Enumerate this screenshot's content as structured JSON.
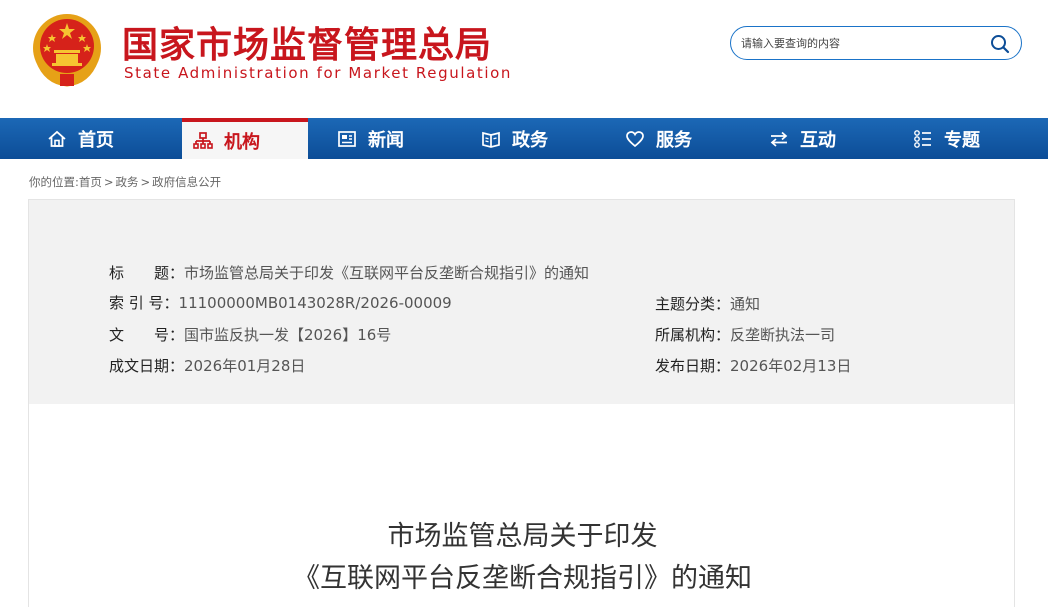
{
  "header": {
    "title_cn": "国家市场监督管理总局",
    "title_en": "State Administration for Market Regulation",
    "emblem_icon": "national-emblem-icon"
  },
  "search": {
    "placeholder": "请输入要查询的内容",
    "icon": "search-icon"
  },
  "nav": {
    "items": [
      {
        "label": "首页",
        "icon": "home-icon"
      },
      {
        "label": "机构",
        "icon": "org-chart-icon",
        "active": true
      },
      {
        "label": "新闻",
        "icon": "news-icon"
      },
      {
        "label": "政务",
        "icon": "book-icon"
      },
      {
        "label": "服务",
        "icon": "heart-icon"
      },
      {
        "label": "互动",
        "icon": "exchange-icon"
      },
      {
        "label": "专题",
        "icon": "list-icon"
      }
    ]
  },
  "breadcrumb": {
    "prefix": "你的位置:",
    "items": [
      "首页",
      "政务",
      "政府信息公开"
    ],
    "separator": ">"
  },
  "meta": {
    "title_key": "标　　题：",
    "title_val": "市场监管总局关于印发《互联网平台反垄断合规指引》的通知",
    "index_key": "索 引 号：",
    "index_val": "11100000MB0143028R/2026-00009",
    "category_key": "主题分类：",
    "category_val": "通知",
    "docno_key": "文　　号：",
    "docno_val": "国市监反执一发【2026】16号",
    "org_key": "所属机构：",
    "org_val": "反垄断执法一司",
    "created_key": "成文日期：",
    "created_val": "2026年01月28日",
    "published_key": "发布日期：",
    "published_val": "2026年02月13日"
  },
  "article": {
    "title_line1": "市场监管总局关于印发",
    "title_line2": "《互联网平台反垄断合规指引》的通知"
  },
  "colors": {
    "brand_red": "#c8161d",
    "nav_blue": "#0c4d97",
    "meta_bg": "#f2f2f2"
  }
}
